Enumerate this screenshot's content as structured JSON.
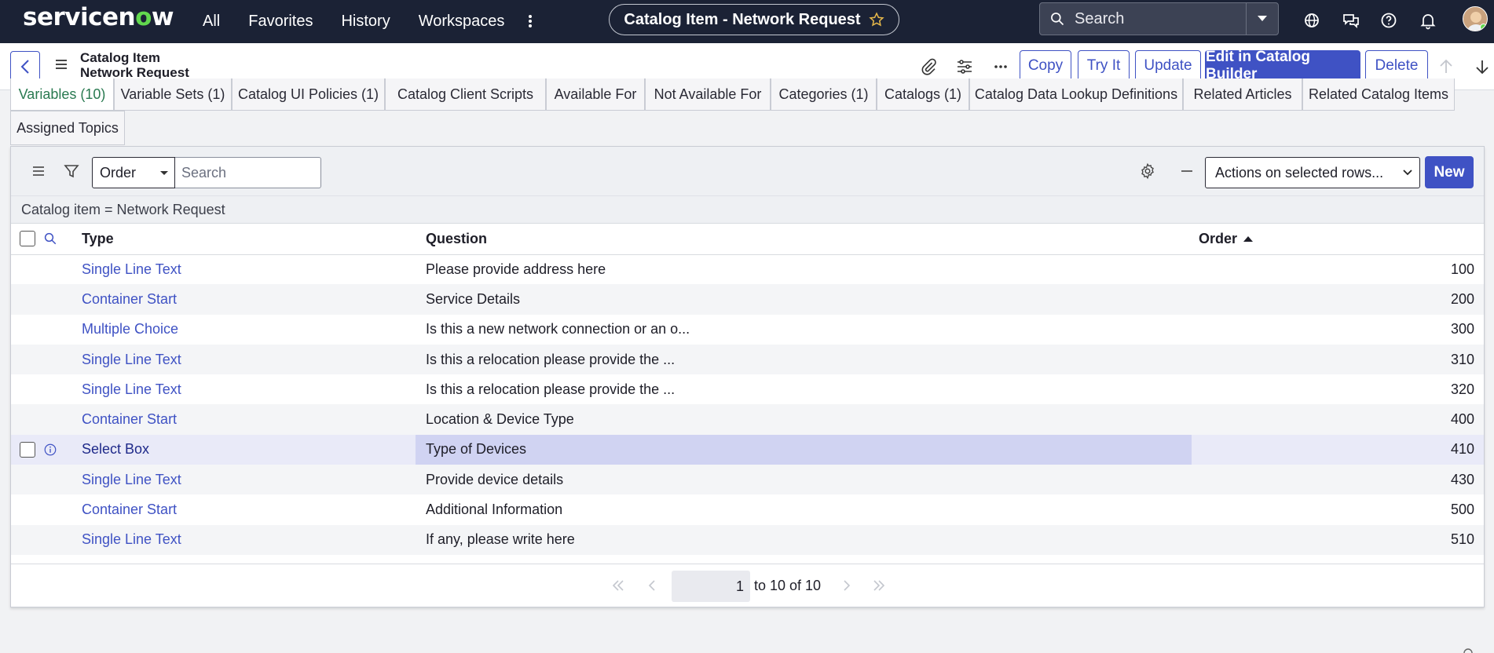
{
  "nav": {
    "logo_pre": "servicen",
    "logo_o": "o",
    "logo_post": "w",
    "links": [
      "All",
      "Favorites",
      "History",
      "Workspaces"
    ],
    "context_title": "Catalog Item - Network Request",
    "search_placeholder": "Search"
  },
  "form": {
    "title_line1": "Catalog Item",
    "title_line2": "Network Request",
    "buttons": {
      "copy": "Copy",
      "try_it": "Try It",
      "update": "Update",
      "edit_builder": "Edit in Catalog Builder",
      "delete": "Delete"
    }
  },
  "tabs": [
    "Variables (10)",
    "Variable Sets (1)",
    "Catalog UI Policies (1)",
    "Catalog Client Scripts",
    "Available For",
    "Not Available For",
    "Categories (1)",
    "Catalogs (1)",
    "Catalog Data Lookup Definitions",
    "Related Articles",
    "Related Catalog Items",
    "Assigned Topics"
  ],
  "list": {
    "order_select": "Order",
    "search_placeholder": "Search",
    "actions_select": "Actions on selected rows...",
    "new_label": "New",
    "breadcrumb": "Catalog item = Network Request",
    "columns": {
      "type": "Type",
      "question": "Question",
      "order": "Order"
    },
    "rows": [
      {
        "type": "Single Line Text",
        "question": "Please provide address here",
        "order": "100"
      },
      {
        "type": "Container Start",
        "question": "Service Details",
        "order": "200"
      },
      {
        "type": "Multiple Choice",
        "question": "Is this a new network connection or an o...",
        "order": "300"
      },
      {
        "type": "Single Line Text",
        "question": "Is this a relocation please provide the ...",
        "order": "310"
      },
      {
        "type": "Single Line Text",
        "question": "Is this a relocation please provide the ...",
        "order": "320"
      },
      {
        "type": "Container Start",
        "question": "Location & Device Type",
        "order": "400"
      },
      {
        "type": "Select Box",
        "question": "Type of Devices",
        "order": "410"
      },
      {
        "type": "Single Line Text",
        "question": "Provide device details",
        "order": "430"
      },
      {
        "type": "Container Start",
        "question": "Additional Information",
        "order": "500"
      },
      {
        "type": "Single Line Text",
        "question": "If any, please write here",
        "order": "510"
      }
    ],
    "pager": {
      "current": "1",
      "summary": "to 10 of 10"
    }
  },
  "colors": {
    "accent": "#3f52c4",
    "nav_bg": "#1b2235",
    "active_tab": "#2a7a51",
    "brand_green": "#62d84e"
  }
}
